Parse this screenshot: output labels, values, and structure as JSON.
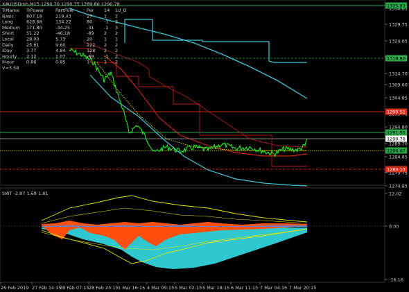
{
  "symbol_header": "XAUUSDmh,M15  1290.70 1290.75 1289.80 1290.78",
  "info_table": {
    "headers": [
      "TrName",
      "TrPower",
      "PartPow",
      "Per",
      "14",
      "1d_D"
    ],
    "rows": [
      [
        "Basic",
        "807.18",
        "219.43",
        "27",
        "1",
        "2"
      ],
      [
        "Long",
        "628.68",
        "134.22",
        "80",
        "-1",
        "2"
      ],
      [
        "Medium",
        "171.80",
        "-34.25",
        "-31",
        "-1",
        "3"
      ],
      [
        "Short",
        "51.22",
        "-46.18",
        "-89",
        "2",
        "2"
      ],
      [
        "Local",
        "28.00",
        "5.73",
        "20",
        "1",
        "1"
      ],
      [
        "Daily",
        "25.61",
        "9.60",
        "222",
        "2",
        "2"
      ],
      [
        "IDay",
        "3.77",
        "4.84",
        "128",
        "2",
        "2"
      ],
      [
        "Hourly",
        "2.12",
        "1.07",
        "-69",
        "-1",
        "2"
      ],
      [
        "IHour",
        "0.86",
        "0.85",
        "1",
        "1",
        "2"
      ]
    ],
    "footer": "V=3.58"
  },
  "price_axis": {
    "ticks": [
      "1334.85",
      "1329.75",
      "1324.65",
      "1319.80",
      "1314.70",
      "1309.60",
      "1304.85",
      "1299.75",
      "1294.80",
      "1289.70",
      "1284.85",
      "1279.75",
      "1274.85"
    ],
    "labels": [
      {
        "text": "1335.82",
        "bg": "#2aa84a",
        "fg": "#000000"
      },
      {
        "text": "1318.80",
        "bg": "#2aa84a",
        "fg": "#000000"
      },
      {
        "text": "1299.51",
        "bg": "#d8301c",
        "fg": "#ffffff"
      },
      {
        "text": "1291.95",
        "bg": "#2aa84a",
        "fg": "#000000"
      },
      {
        "text": "1290.78",
        "bg": "#ffffff",
        "fg": "#000000"
      },
      {
        "text": "1286.67",
        "bg": "#2aa84a",
        "fg": "#000000"
      },
      {
        "text": "1280.13",
        "bg": "#d8301c",
        "fg": "#ffffff"
      }
    ]
  },
  "indicator": {
    "label": "SWT -2.87 1.69 1.81",
    "ticks": [
      "12.02",
      "0.00",
      "-16.16"
    ]
  },
  "time_axis": [
    "26 Feb 2019",
    "27 Feb 14:15",
    "28 Feb 07:15",
    "28 Feb 23:15",
    "1 Mar 16:15",
    "4 Mar 09:15",
    "5 Mar 02:15",
    "5 Mar 18:15",
    "6 Mar 11:15",
    "7 Mar 04:15",
    "7 Mar 20:15"
  ],
  "colors": {
    "price": "#22ee22",
    "cyan": "#3fc6d8",
    "red_dark": "#b02010",
    "red": "#ff3018",
    "yellow": "#e8e800",
    "green_line": "#2aa84a",
    "white_line": "#ffffff",
    "fill_orange": "#ff5010",
    "fill_cyan": "#30c8d0",
    "fill_blue": "#6080d0"
  }
}
